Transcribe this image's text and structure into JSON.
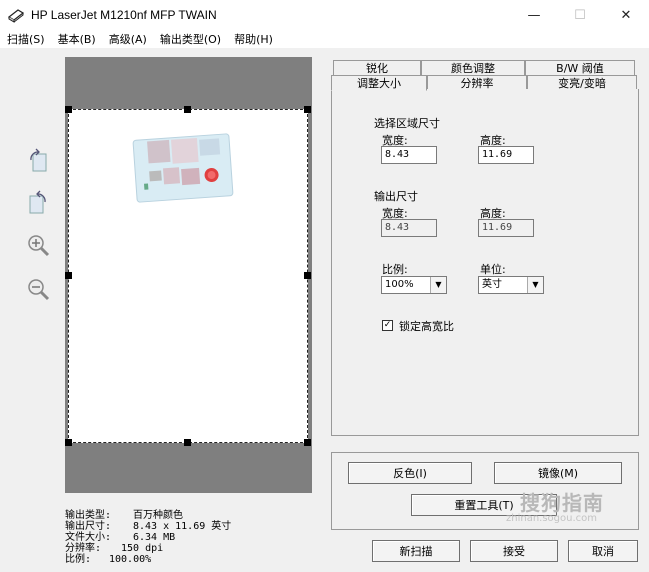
{
  "window": {
    "title": "HP LaserJet M1210nf MFP TWAIN",
    "minimize": "—",
    "maximize": "☐",
    "close": "✕"
  },
  "menu": [
    "扫描(S)",
    "基本(B)",
    "高级(A)",
    "输出类型(O)",
    "帮助(H)"
  ],
  "tools": [
    "rotate-left-icon",
    "rotate-right-icon",
    "zoom-in-icon",
    "zoom-out-icon"
  ],
  "tabs": {
    "row1": [
      "锐化",
      "颜色调整",
      "B/W 阈值"
    ],
    "row2": [
      "调整大小",
      "分辨率",
      "变亮/变暗"
    ]
  },
  "resize_panel": {
    "selection_title": "选择区域尺寸",
    "width_label": "宽度:",
    "height_label": "高度:",
    "sel_width": "8.43",
    "sel_height": "11.69",
    "output_title": "输出尺寸",
    "out_width": "8.43",
    "out_height": "11.69",
    "scale_label": "比例:",
    "unit_label": "单位:",
    "scale_value": "100%",
    "unit_value": "英寸",
    "lock_ratio_label": "锁定高宽比",
    "lock_ratio_checked": true
  },
  "buttons": {
    "invert": "反色(I)",
    "mirror": "镜像(M)",
    "reset_tool": "重置工具(T)",
    "new_scan": "新扫描",
    "accept": "接受",
    "cancel": "取消"
  },
  "info": [
    {
      "key": "输出类型:",
      "value": "百万种颜色"
    },
    {
      "key": "输出尺寸:",
      "value": "8.43 x 11.69 英寸"
    },
    {
      "key": "文件大小:",
      "value": "6.34 MB"
    },
    {
      "key": "分辨率:",
      "value": "150 dpi"
    },
    {
      "key": "比例:",
      "value": "100.00%"
    }
  ],
  "watermark": {
    "text": "搜狗指南",
    "url": "zhinan.sogou.com"
  }
}
